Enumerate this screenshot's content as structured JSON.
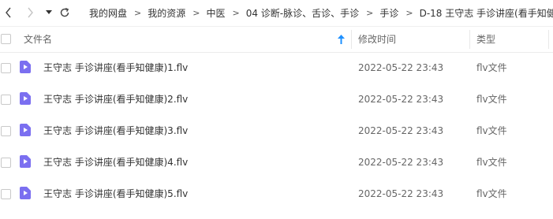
{
  "toolbar": {
    "back_icon": "chevron-left-icon",
    "forward_icon": "chevron-right-icon",
    "history_icon": "caret-down-icon",
    "refresh_icon": "refresh-icon"
  },
  "breadcrumb": [
    "我的网盘",
    "我的资源",
    "中医",
    "04 诊断-脉诊、舌诊、手诊",
    "手诊",
    "D-18 王守志 手诊讲座(看手知健康"
  ],
  "breadcrumb_separator": ">",
  "columns": {
    "name": "文件名",
    "modified": "修改时间",
    "type": "类型",
    "sort_icon": "sort-ascending-arrow-icon"
  },
  "files": [
    {
      "name": "王守志 手诊讲座(看手知健康)1.flv",
      "modified": "2022-05-22 23:43",
      "type": "flv文件",
      "icon": "video-file-icon"
    },
    {
      "name": "王守志 手诊讲座(看手知健康)2.flv",
      "modified": "2022-05-22 23:43",
      "type": "flv文件",
      "icon": "video-file-icon"
    },
    {
      "name": "王守志 手诊讲座(看手知健康)3.flv",
      "modified": "2022-05-22 23:43",
      "type": "flv文件",
      "icon": "video-file-icon"
    },
    {
      "name": "王守志 手诊讲座(看手知健康)4.flv",
      "modified": "2022-05-22 23:43",
      "type": "flv文件",
      "icon": "video-file-icon"
    },
    {
      "name": "王守志 手诊讲座(看手知健康)5.flv",
      "modified": "2022-05-22 23:43",
      "type": "flv文件",
      "icon": "video-file-icon"
    }
  ],
  "colors": {
    "file_icon": "#7b6ff0",
    "sort_arrow": "#1e90ff"
  }
}
